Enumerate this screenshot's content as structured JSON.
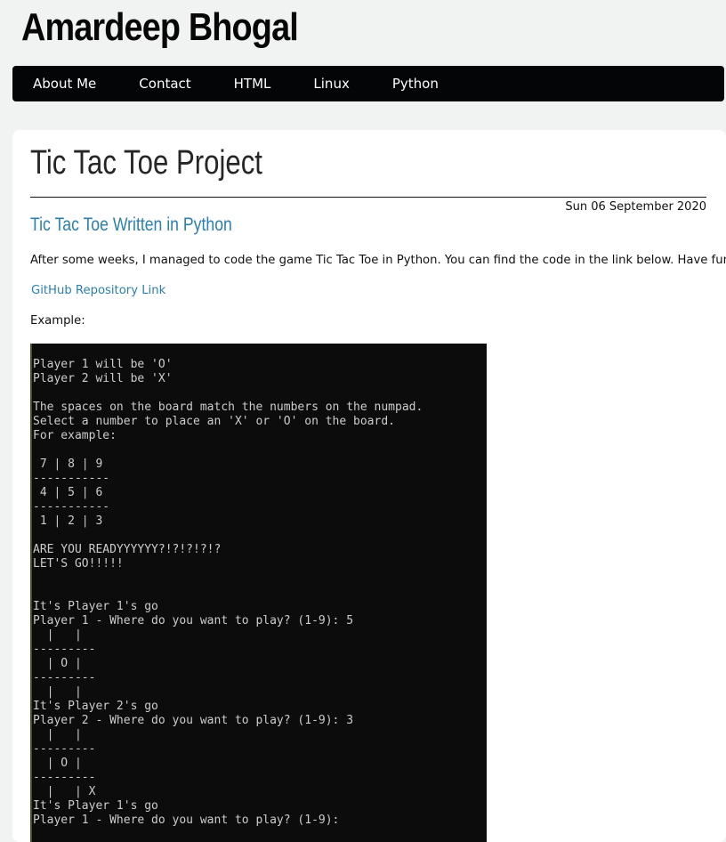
{
  "site": {
    "title": "Amardeep Bhogal"
  },
  "nav": {
    "items": [
      {
        "label": "About Me"
      },
      {
        "label": "Contact"
      },
      {
        "label": "HTML"
      },
      {
        "label": "Linux"
      },
      {
        "label": "Python"
      }
    ]
  },
  "page": {
    "title": "Tic Tac Toe Project"
  },
  "post": {
    "date": "Sun 06 September 2020",
    "heading": "Tic Tac Toe Written in Python",
    "intro": "After some weeks, I managed to code the game Tic Tac Toe in Python. You can find the code in the link below. Have fun!",
    "link_label": "GitHub Repository Link",
    "example_label": "Example:"
  },
  "terminal": {
    "background": "#0c0c0c",
    "text_color": "#cccccc",
    "output": "Player 1 will be 'O'\nPlayer 2 will be 'X'\n\nThe spaces on the board match the numbers on the numpad.\nSelect a number to place an 'X' or 'O' on the board.\nFor example:\n\n 7 | 8 | 9\n-----------\n 4 | 5 | 6\n-----------\n 1 | 2 | 3\n\nARE YOU READYYYYYY?!?!?!?!?\nLET'S GO!!!!!\n\n\nIt's Player 1's go\nPlayer 1 - Where do you want to play? (1-9): 5\n  |   |\n---------\n  | O |\n---------\n  |   |\nIt's Player 2's go\nPlayer 2 - Where do you want to play? (1-9): 3\n  |   |\n---------\n  | O |\n---------\n  |   | X\nIt's Player 1's go\nPlayer 1 - Where do you want to play? (1-9):"
  },
  "colors": {
    "page_background": "#f1f2f2",
    "nav_background": "#030506",
    "link": "#2b7fae"
  }
}
